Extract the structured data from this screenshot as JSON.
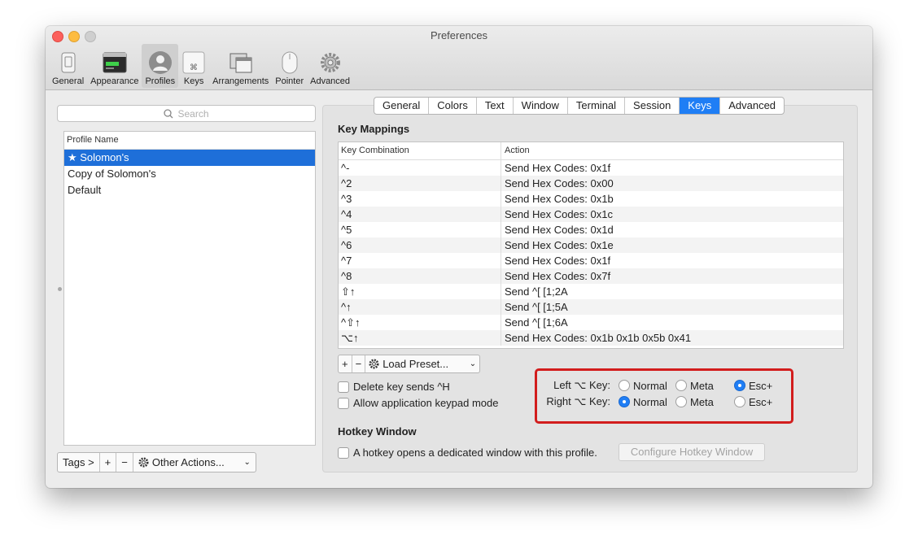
{
  "window": {
    "title": "Preferences"
  },
  "toolbar": {
    "items": [
      {
        "label": "General",
        "icon": "phone-icon"
      },
      {
        "label": "Appearance",
        "icon": "terminal-window-icon"
      },
      {
        "label": "Profiles",
        "icon": "user-silhouette-icon"
      },
      {
        "label": "Keys",
        "icon": "command-key-icon"
      },
      {
        "label": "Arrangements",
        "icon": "window-arrangement-icon"
      },
      {
        "label": "Pointer",
        "icon": "mouse-icon"
      },
      {
        "label": "Advanced",
        "icon": "gear-icon"
      }
    ],
    "active": "Profiles"
  },
  "sidebar": {
    "search_placeholder": "Search",
    "list_header": "Profile Name",
    "profiles": [
      "★ Solomon's",
      "Copy of Solomon's",
      "Default"
    ],
    "selected": "★ Solomon's",
    "tags_label": "Tags >",
    "add_label": "+",
    "remove_label": "−",
    "other_actions_label": "Other Actions..."
  },
  "tabs": {
    "items": [
      "General",
      "Colors",
      "Text",
      "Window",
      "Terminal",
      "Session",
      "Keys",
      "Advanced"
    ],
    "active": "Keys"
  },
  "key_mappings": {
    "title": "Key Mappings",
    "col_key": "Key Combination",
    "col_action": "Action",
    "rows": [
      {
        "key": "^-",
        "action": "Send Hex Codes: 0x1f"
      },
      {
        "key": "^2",
        "action": "Send Hex Codes: 0x00"
      },
      {
        "key": "^3",
        "action": "Send Hex Codes: 0x1b"
      },
      {
        "key": "^4",
        "action": "Send Hex Codes: 0x1c"
      },
      {
        "key": "^5",
        "action": "Send Hex Codes: 0x1d"
      },
      {
        "key": "^6",
        "action": "Send Hex Codes: 0x1e"
      },
      {
        "key": "^7",
        "action": "Send Hex Codes: 0x1f"
      },
      {
        "key": "^8",
        "action": "Send Hex Codes: 0x7f"
      },
      {
        "key": "⇧↑",
        "action": "Send ^[ [1;2A"
      },
      {
        "key": "^↑",
        "action": "Send ^[ [1;5A"
      },
      {
        "key": "^⇧↑",
        "action": "Send ^[ [1;6A"
      },
      {
        "key": "⌥↑",
        "action": "Send Hex Codes: 0x1b 0x1b 0x5b 0x41"
      }
    ],
    "add_label": "+",
    "remove_label": "−",
    "load_preset_label": "Load Preset..."
  },
  "checkboxes": {
    "delete_sends_h": {
      "label": "Delete key sends ^H",
      "checked": false
    },
    "keypad_mode": {
      "label": "Allow application keypad mode",
      "checked": false
    }
  },
  "option_keys": {
    "left_label": "Left ⌥ Key:",
    "right_label": "Right ⌥ Key:",
    "choices": [
      "Normal",
      "Meta",
      "Esc+"
    ],
    "left_selected": "Esc+",
    "right_selected": "Normal"
  },
  "hotkey": {
    "title": "Hotkey Window",
    "checkbox_label": "A hotkey opens a dedicated window with this profile.",
    "checked": false,
    "configure_label": "Configure Hotkey Window"
  },
  "colors": {
    "accent": "#1f7ef5",
    "selection": "#1e6fd9",
    "highlight_box": "#d21d1d"
  }
}
